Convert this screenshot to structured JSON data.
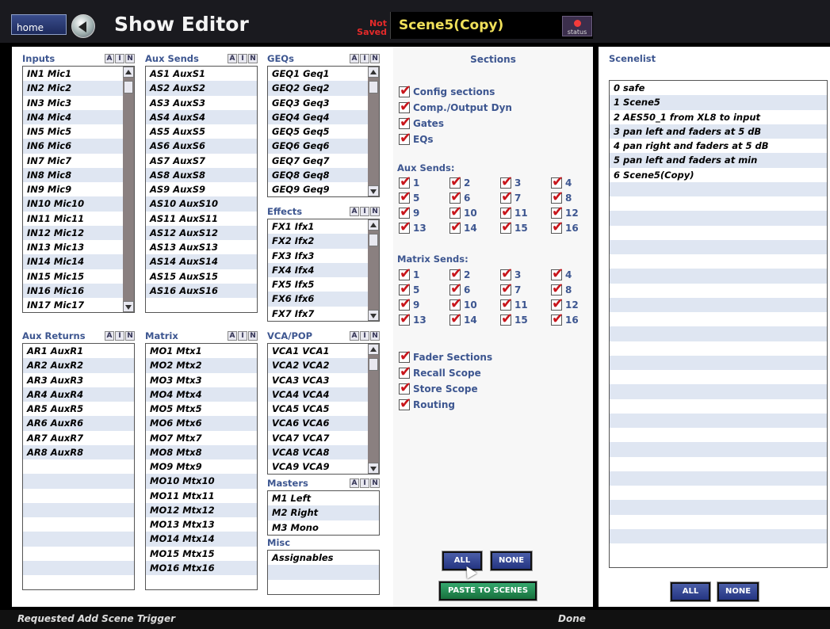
{
  "header": {
    "home_label": "home",
    "title": "Show Editor",
    "save_status": "Not Saved",
    "scene_name": "Scene5(Copy)",
    "status_label": "status"
  },
  "ain_buttons": [
    "A",
    "I",
    "N"
  ],
  "inputs": {
    "label": "Inputs",
    "items": [
      "IN1 Mic1",
      "IN2 Mic2",
      "IN3 Mic3",
      "IN4 Mic4",
      "IN5 Mic5",
      "IN6 Mic6",
      "IN7 Mic7",
      "IN8 Mic8",
      "IN9 Mic9",
      "IN10 Mic10",
      "IN11 Mic11",
      "IN12 Mic12",
      "IN13 Mic13",
      "IN14 Mic14",
      "IN15 Mic15",
      "IN16 Mic16",
      "IN17 Mic17"
    ]
  },
  "aux_sends": {
    "label": "Aux Sends",
    "items": [
      "AS1 AuxS1",
      "AS2 AuxS2",
      "AS3 AuxS3",
      "AS4 AuxS4",
      "AS5 AuxS5",
      "AS6 AuxS6",
      "AS7 AuxS7",
      "AS8 AuxS8",
      "AS9 AuxS9",
      "AS10 AuxS10",
      "AS11 AuxS11",
      "AS12 AuxS12",
      "AS13 AuxS13",
      "AS14 AuxS14",
      "AS15 AuxS15",
      "AS16 AuxS16"
    ]
  },
  "geqs": {
    "label": "GEQs",
    "items": [
      "GEQ1 Geq1",
      "GEQ2 Geq2",
      "GEQ3 Geq3",
      "GEQ4 Geq4",
      "GEQ5 Geq5",
      "GEQ6 Geq6",
      "GEQ7 Geq7",
      "GEQ8 Geq8",
      "GEQ9 Geq9"
    ]
  },
  "effects": {
    "label": "Effects",
    "items": [
      "FX1 Ifx1",
      "FX2 Ifx2",
      "FX3 Ifx3",
      "FX4 Ifx4",
      "FX5 Ifx5",
      "FX6 Ifx6",
      "FX7 Ifx7"
    ]
  },
  "aux_returns": {
    "label": "Aux Returns",
    "items": [
      "AR1 AuxR1",
      "AR2 AuxR2",
      "AR3 AuxR3",
      "AR4 AuxR4",
      "AR5 AuxR5",
      "AR6 AuxR6",
      "AR7 AuxR7",
      "AR8 AuxR8"
    ]
  },
  "matrix": {
    "label": "Matrix",
    "items": [
      "MO1 Mtx1",
      "MO2 Mtx2",
      "MO3 Mtx3",
      "MO4 Mtx4",
      "MO5 Mtx5",
      "MO6 Mtx6",
      "MO7 Mtx7",
      "MO8 Mtx8",
      "MO9 Mtx9",
      "MO10 Mtx10",
      "MO11 Mtx11",
      "MO12 Mtx12",
      "MO13 Mtx13",
      "MO14 Mtx14",
      "MO15 Mtx15",
      "MO16 Mtx16"
    ]
  },
  "vca_pop": {
    "label": "VCA/POP",
    "items": [
      "VCA1 VCA1",
      "VCA2 VCA2",
      "VCA3 VCA3",
      "VCA4 VCA4",
      "VCA5 VCA5",
      "VCA6 VCA6",
      "VCA7 VCA7",
      "VCA8 VCA8",
      "VCA9 VCA9"
    ]
  },
  "masters": {
    "label": "Masters",
    "items": [
      "M1 Left",
      "M2 Right",
      "M3 Mono"
    ]
  },
  "misc": {
    "label": "Misc",
    "items": [
      "Assignables"
    ]
  },
  "sections": {
    "title": "Sections",
    "top_options": [
      "Config sections",
      "Comp./Output Dyn",
      "Gates",
      "EQs"
    ],
    "aux_sends_label": "Aux Sends:",
    "matrix_sends_label": "Matrix Sends:",
    "numbers": [
      "1",
      "2",
      "3",
      "4",
      "5",
      "6",
      "7",
      "8",
      "9",
      "10",
      "11",
      "12",
      "13",
      "14",
      "15",
      "16"
    ],
    "bottom_options": [
      "Fader Sections",
      "Recall Scope",
      "Store Scope",
      "Routing"
    ],
    "all_label": "ALL",
    "none_label": "NONE",
    "paste_label": "PASTE TO SCENES"
  },
  "scenelist": {
    "title": "Scenelist",
    "items": [
      "0 safe",
      "1 Scene5",
      "2 AES50_1 from XL8 to input",
      "3 pan left and faders at 5 dB",
      "4 pan right and faders at 5 dB",
      "5 pan left and faders at min",
      "6 Scene5(Copy)"
    ],
    "all_label": "ALL",
    "none_label": "NONE"
  },
  "statusbar": {
    "message": "Requested Add Scene Trigger",
    "state": "Done"
  }
}
